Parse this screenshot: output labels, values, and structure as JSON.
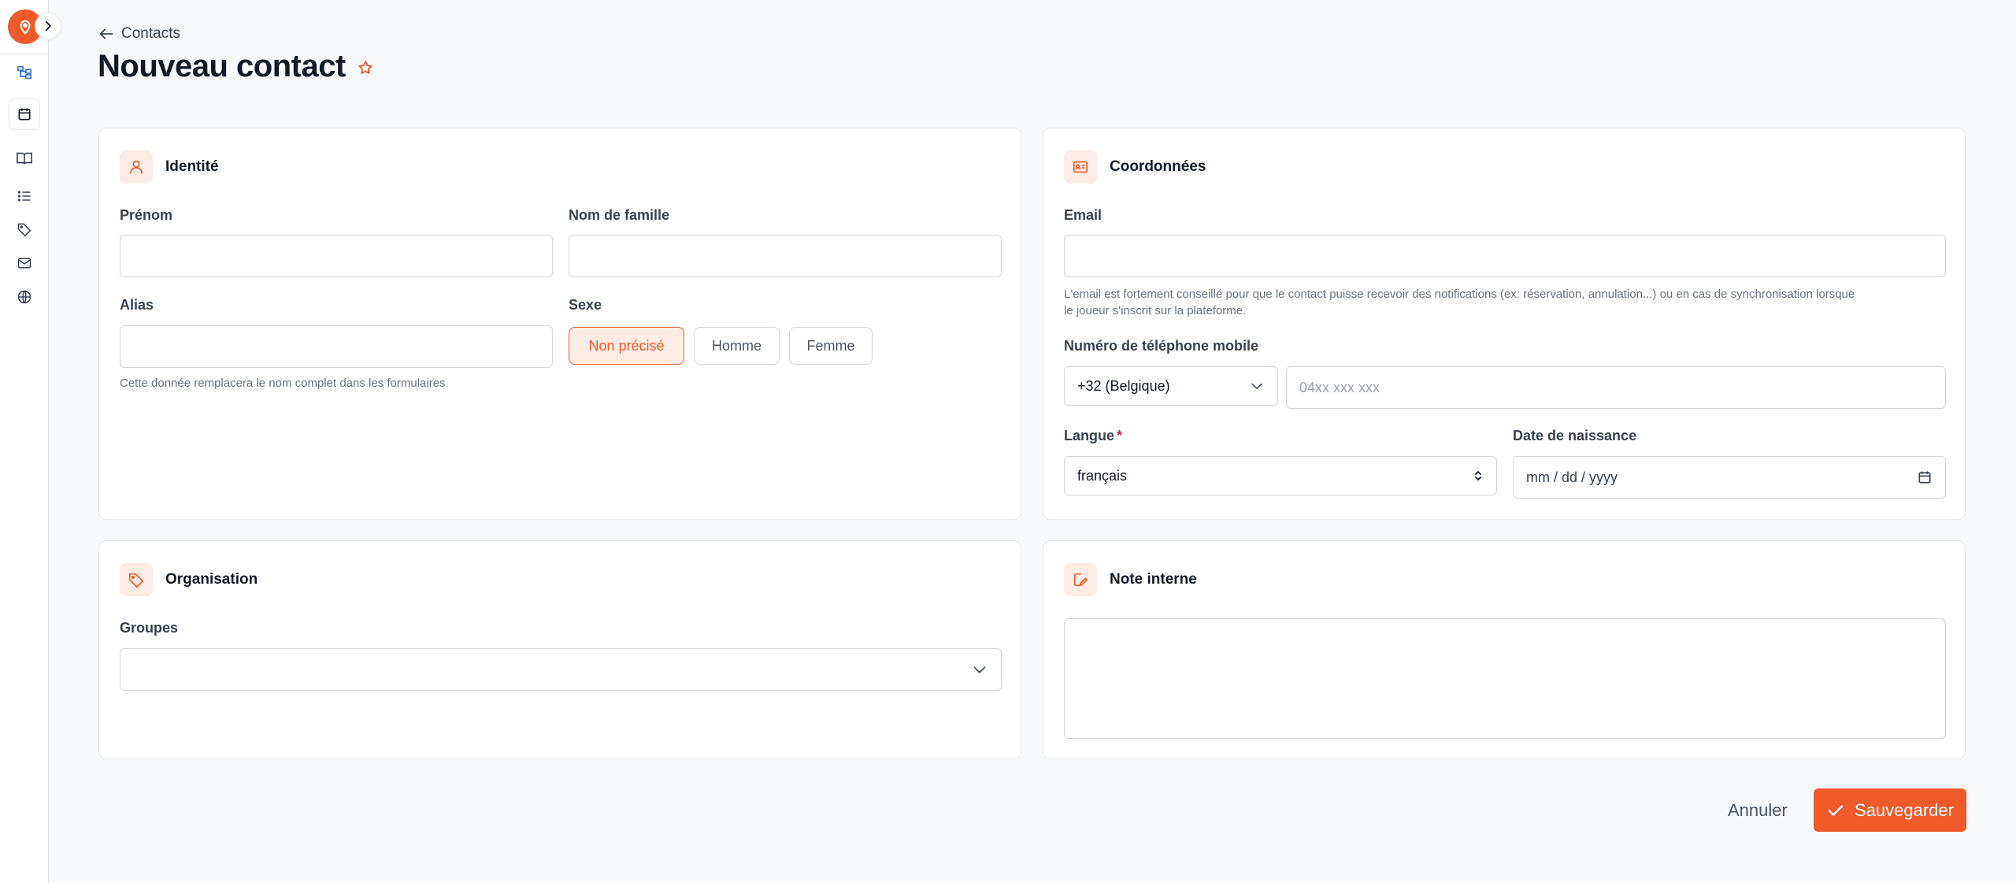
{
  "theme": {
    "accent": "#ee5a2a",
    "accent_soft": "#fdece4",
    "link": "#2f6fdf"
  },
  "sidebar": {
    "logo_icon": "brand-pin-icon",
    "expand_icon": "chevron-right-icon",
    "items": [
      {
        "name": "hierarchy",
        "icon": "hierarchy-icon"
      },
      {
        "name": "calendar",
        "icon": "calendar-icon"
      },
      {
        "name": "book",
        "icon": "book-open-icon"
      },
      {
        "name": "list",
        "icon": "list-icon"
      },
      {
        "name": "tags",
        "icon": "tag-icon"
      },
      {
        "name": "mail",
        "icon": "mail-icon"
      },
      {
        "name": "globe",
        "icon": "globe-icon"
      }
    ]
  },
  "header": {
    "back_label": "Contacts",
    "title": "Nouveau contact",
    "favorite_icon": "star-icon"
  },
  "identity": {
    "title": "Identité",
    "icon": "user-icon",
    "first_name_label": "Prénom",
    "first_name_value": "",
    "last_name_label": "Nom de famille",
    "last_name_value": "",
    "alias_label": "Alias",
    "alias_value": "",
    "alias_help": "Cette donnée remplacera le nom complet dans les formulaires",
    "gender_label": "Sexe",
    "gender_options": [
      "Non précisé",
      "Homme",
      "Femme"
    ],
    "gender_selected": "Non précisé"
  },
  "contact": {
    "title": "Coordonnées",
    "icon": "contact-card-icon",
    "email_label": "Email",
    "email_value": "",
    "email_help_line1": "L'email est fortement conseillé pour que le contact puisse recevoir des notifications (ex: réservation, annulation...) ou en cas de synchronisation lorsque",
    "email_help_line2": "le joueur s'inscrit sur la plateforme.",
    "phone_label": "Numéro de téléphone mobile",
    "phone_country": "+32 (Belgique)",
    "phone_placeholder": "04xx xxx xxx",
    "language_label": "Langue",
    "language_required": "*",
    "language_value": "français",
    "birthdate_label": "Date de naissance",
    "birthdate_placeholder": "mm / dd / yyyy"
  },
  "organisation": {
    "title": "Organisation",
    "icon": "tag-icon",
    "groups_label": "Groupes",
    "groups_value": ""
  },
  "note": {
    "title": "Note interne",
    "icon": "edit-note-icon",
    "value": ""
  },
  "actions": {
    "cancel_label": "Annuler",
    "save_label": "Sauvegarder"
  }
}
